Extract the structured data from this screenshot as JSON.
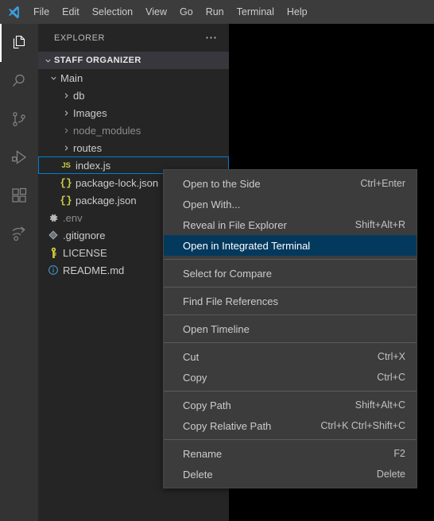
{
  "titlebar": {
    "logo_icon": "vscode-logo-icon",
    "menus": [
      "File",
      "Edit",
      "Selection",
      "View",
      "Go",
      "Run",
      "Terminal",
      "Help"
    ]
  },
  "activitybar": {
    "items": [
      {
        "name": "explorer",
        "icon": "files-icon",
        "active": true
      },
      {
        "name": "search",
        "icon": "search-icon",
        "active": false
      },
      {
        "name": "source-control",
        "icon": "source-control-icon",
        "active": false
      },
      {
        "name": "run-and-debug",
        "icon": "run-and-debug-icon",
        "active": false
      },
      {
        "name": "extensions",
        "icon": "extensions-icon",
        "active": false
      },
      {
        "name": "remote-explorer",
        "icon": "remote-share-icon",
        "active": false
      }
    ]
  },
  "sidebar": {
    "header_title": "EXPLORER",
    "more_actions_icon": "ellipsis-icon",
    "section": {
      "title": "STAFF ORGANIZER",
      "expanded": true
    },
    "tree": [
      {
        "label": "Main",
        "kind": "folder",
        "indent": 1,
        "expanded": true,
        "icon": "chevron-down-icon",
        "dim": false,
        "focused": false
      },
      {
        "label": "db",
        "kind": "folder",
        "indent": 2,
        "expanded": false,
        "icon": "chevron-right-icon",
        "dim": false,
        "focused": false
      },
      {
        "label": "Images",
        "kind": "folder",
        "indent": 2,
        "expanded": false,
        "icon": "chevron-right-icon",
        "dim": false,
        "focused": false
      },
      {
        "label": "node_modules",
        "kind": "folder",
        "indent": 2,
        "expanded": false,
        "icon": "chevron-right-icon",
        "dim": true,
        "focused": false
      },
      {
        "label": "routes",
        "kind": "folder",
        "indent": 2,
        "expanded": false,
        "icon": "chevron-right-icon",
        "dim": false,
        "focused": false
      },
      {
        "label": "index.js",
        "kind": "file",
        "indent": 2,
        "icon": "js-file-icon",
        "dim": false,
        "focused": true
      },
      {
        "label": "package-lock.json",
        "kind": "file",
        "indent": 2,
        "icon": "json-file-icon",
        "dim": false,
        "focused": false
      },
      {
        "label": "package.json",
        "kind": "file",
        "indent": 2,
        "icon": "json-file-icon",
        "dim": false,
        "focused": false
      },
      {
        "label": ".env",
        "kind": "file",
        "indent": 1,
        "icon": "gear-file-icon",
        "dim": true,
        "focused": false
      },
      {
        "label": ".gitignore",
        "kind": "file",
        "indent": 1,
        "icon": "git-file-icon",
        "dim": false,
        "focused": false
      },
      {
        "label": "LICENSE",
        "kind": "file",
        "indent": 1,
        "icon": "key-file-icon",
        "dim": false,
        "focused": false
      },
      {
        "label": "README.md",
        "kind": "file",
        "indent": 1,
        "icon": "info-file-icon",
        "dim": false,
        "focused": false
      }
    ]
  },
  "context_menu": {
    "groups": [
      [
        {
          "label": "Open to the Side",
          "keybind": "Ctrl+Enter",
          "selected": false
        },
        {
          "label": "Open With...",
          "keybind": "",
          "selected": false
        },
        {
          "label": "Reveal in File Explorer",
          "keybind": "Shift+Alt+R",
          "selected": false
        },
        {
          "label": "Open in Integrated Terminal",
          "keybind": "",
          "selected": true
        }
      ],
      [
        {
          "label": "Select for Compare",
          "keybind": "",
          "selected": false
        }
      ],
      [
        {
          "label": "Find File References",
          "keybind": "",
          "selected": false
        }
      ],
      [
        {
          "label": "Open Timeline",
          "keybind": "",
          "selected": false
        }
      ],
      [
        {
          "label": "Cut",
          "keybind": "Ctrl+X",
          "selected": false
        },
        {
          "label": "Copy",
          "keybind": "Ctrl+C",
          "selected": false
        }
      ],
      [
        {
          "label": "Copy Path",
          "keybind": "Shift+Alt+C",
          "selected": false
        },
        {
          "label": "Copy Relative Path",
          "keybind": "Ctrl+K Ctrl+Shift+C",
          "selected": false
        }
      ],
      [
        {
          "label": "Rename",
          "keybind": "F2",
          "selected": false
        },
        {
          "label": "Delete",
          "keybind": "Delete",
          "selected": false
        }
      ]
    ]
  },
  "colors": {
    "titlebar_bg": "#3c3c3c",
    "activitybar_bg": "#333333",
    "sidebar_bg": "#252526",
    "editor_bg": "#000000",
    "section_header_bg": "#37373d",
    "menu_bg": "#3c3c3c",
    "selected_item_bg": "#04395e",
    "focus_border": "#007fd4",
    "text": "#cccccc",
    "js_yellow": "#cbcb41"
  }
}
